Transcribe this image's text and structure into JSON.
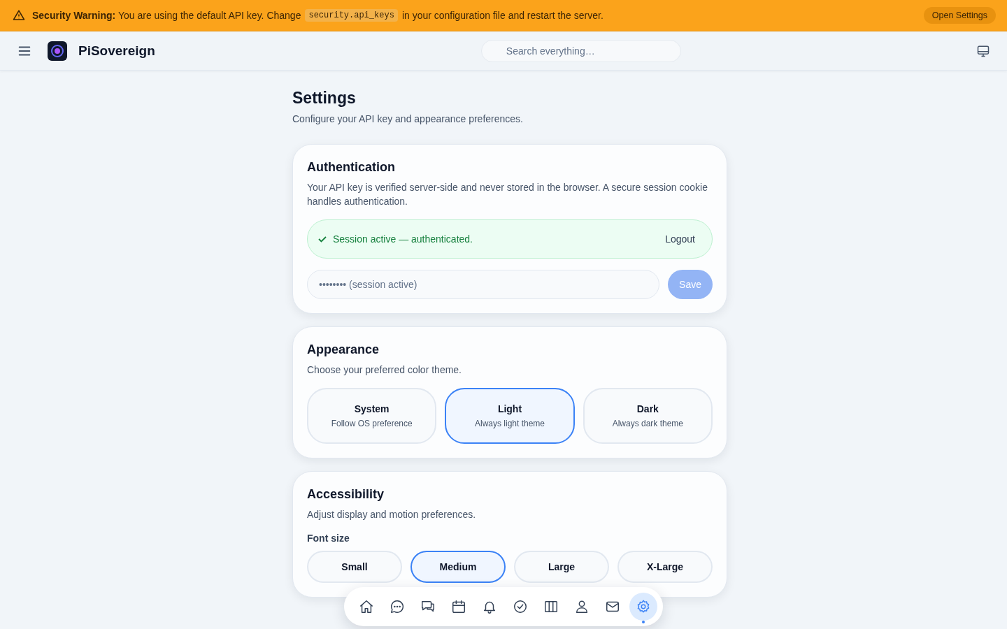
{
  "banner": {
    "lead": "**Security Warning:** You are using the default API key. Change",
    "code": "security.api_keys",
    "tail": "in your configuration file and restart the server.",
    "button": "Open Settings"
  },
  "header": {
    "app_name": "PiSovereign",
    "search": {
      "placeholder": "Search everything…"
    }
  },
  "page": {
    "title": "Settings",
    "subtitle": "Configure your API key and appearance preferences."
  },
  "authentication": {
    "title": "Authentication",
    "description": "Your API key is verified server-side and never stored in the browser. A secure session cookie handles authentication.",
    "session": {
      "message": "Session active — authenticated.",
      "action": "Logout"
    },
    "api_key": {
      "placeholder": "•••••••• (session active)"
    },
    "save": {
      "label": "Save",
      "disabled": true
    }
  },
  "appearance": {
    "title": "Appearance",
    "description": "Choose your preferred color theme.",
    "themes": [
      {
        "label": "System",
        "description": "Follow OS preference",
        "selected": false
      },
      {
        "label": "Light",
        "description": "Always light theme",
        "selected": true
      },
      {
        "label": "Dark",
        "description": "Always dark theme",
        "selected": false
      }
    ]
  },
  "accessibility": {
    "title": "Accessibility",
    "description": "Adjust display and motion preferences.",
    "font_size": {
      "label": "Font size",
      "options": [
        {
          "label": "Small",
          "selected": false
        },
        {
          "label": "Medium",
          "selected": true
        },
        {
          "label": "Large",
          "selected": false
        },
        {
          "label": "X-Large",
          "selected": false
        }
      ]
    }
  },
  "dock": [
    {
      "kind": "home",
      "selected": false
    },
    {
      "kind": "chat",
      "selected": false
    },
    {
      "kind": "conversations",
      "selected": false
    },
    {
      "kind": "calendar",
      "selected": false
    },
    {
      "kind": "bell",
      "selected": false
    },
    {
      "kind": "check",
      "selected": false
    },
    {
      "kind": "columns",
      "selected": false
    },
    {
      "kind": "user",
      "selected": false
    },
    {
      "kind": "mail",
      "selected": false
    },
    {
      "kind": "settings",
      "selected": true
    }
  ]
}
